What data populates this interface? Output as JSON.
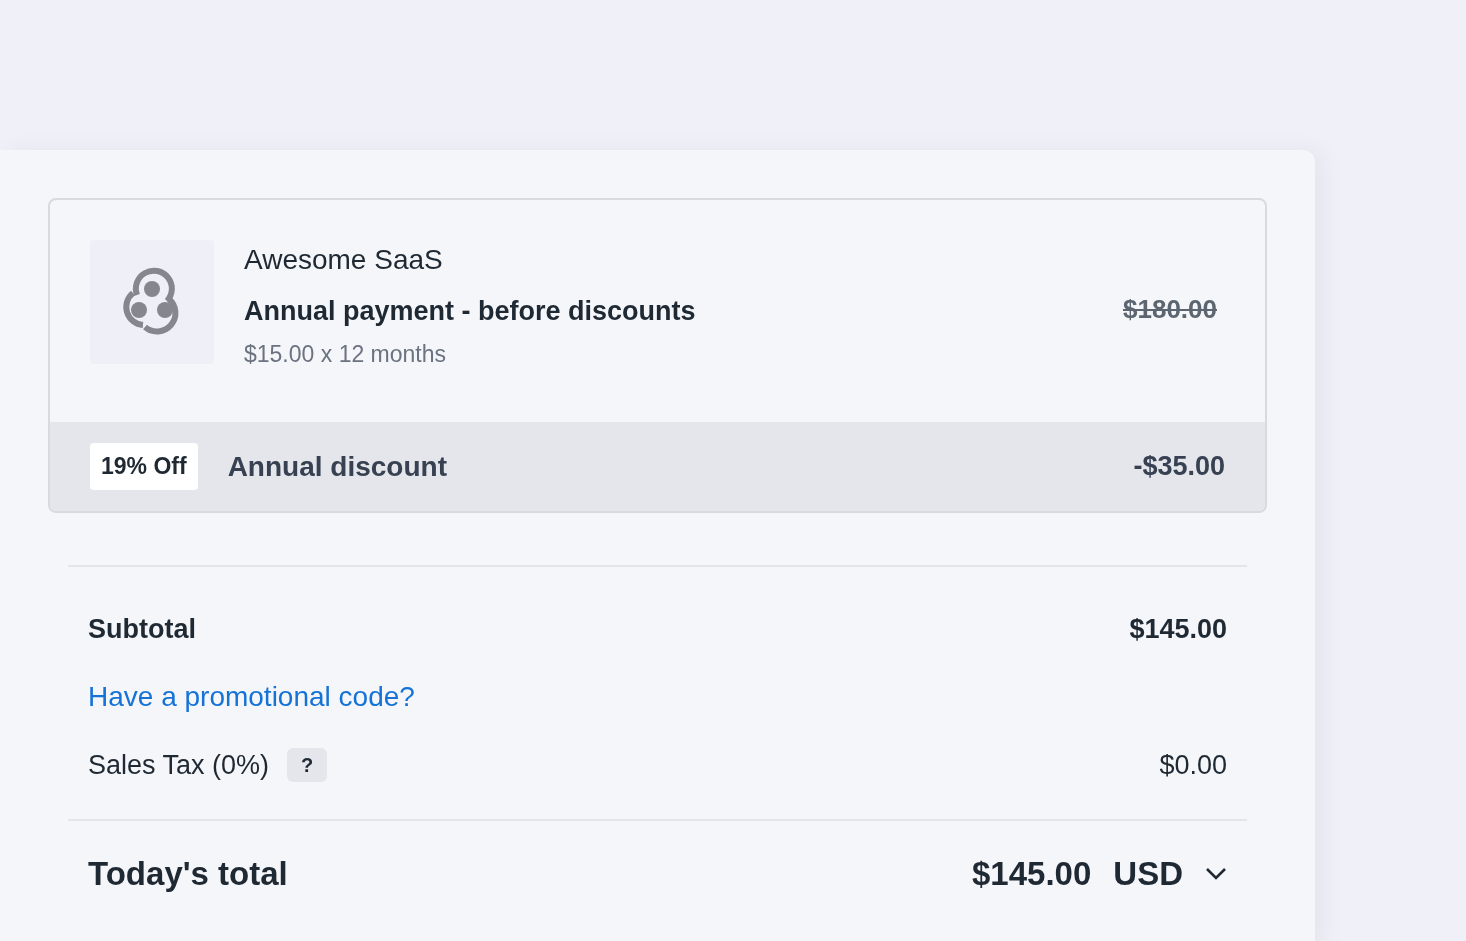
{
  "product": {
    "vendor": "Awesome SaaS",
    "title": "Annual payment - before discounts",
    "detail": "$15.00 x 12 months",
    "price": "$180.00",
    "price_struck": true
  },
  "discount": {
    "badge": "19% Off",
    "label": "Annual discount",
    "amount": "-$35.00"
  },
  "summary": [
    {
      "kind": "subtotal",
      "label": "Subtotal",
      "value": "$145.00"
    },
    {
      "kind": "link",
      "label": "Have a promotional code?"
    },
    {
      "kind": "tax",
      "label": "Sales Tax (0%)",
      "help": "?",
      "value": "$0.00"
    }
  ],
  "total": {
    "label": "Today's total",
    "value": "$145.00",
    "currency": "USD"
  }
}
